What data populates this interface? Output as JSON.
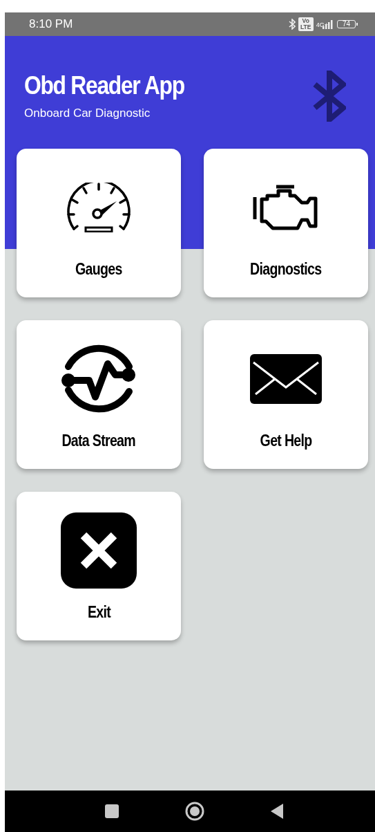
{
  "status_bar": {
    "time": "8:10 PM",
    "volte": [
      "Vo",
      "LTE"
    ],
    "network": "4G+",
    "battery": "74"
  },
  "header": {
    "title": "Obd Reader App",
    "subtitle": "Onboard Car Diagnostic"
  },
  "tiles": [
    {
      "kind": "gauge",
      "label": "Gauges"
    },
    {
      "kind": "engine",
      "label": "Diagnostics"
    },
    {
      "kind": "pulse",
      "label": "Data Stream"
    },
    {
      "kind": "mail",
      "label": "Get Help"
    },
    {
      "kind": "exit",
      "label": "Exit"
    }
  ]
}
